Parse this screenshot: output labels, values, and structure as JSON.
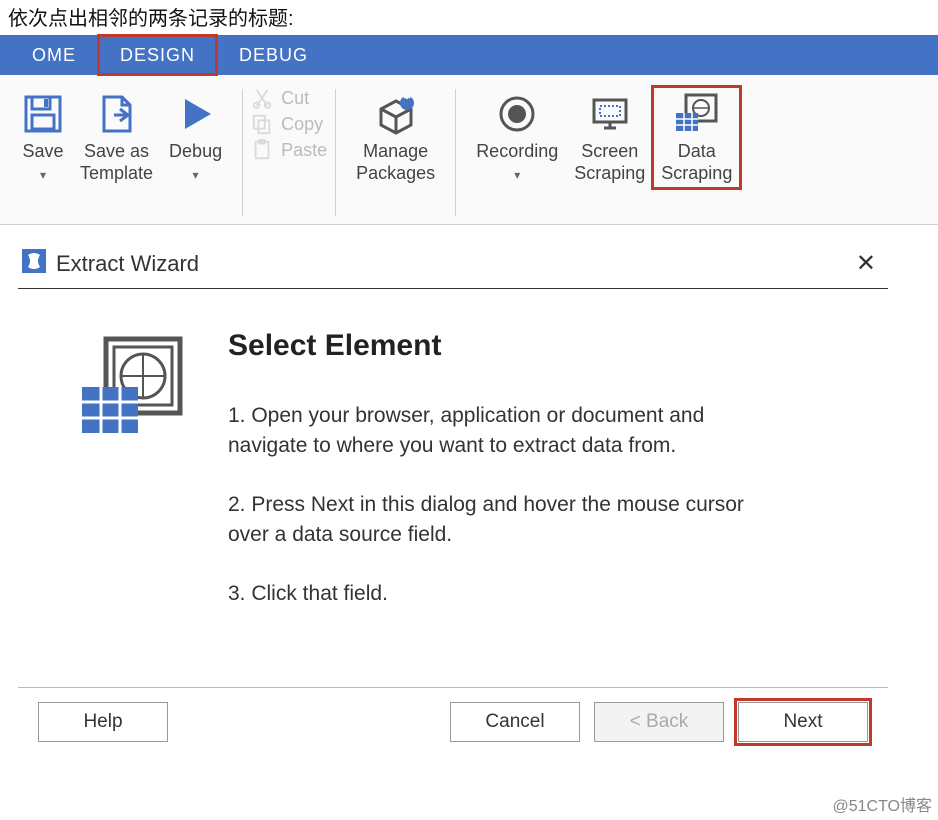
{
  "top_text": "依次点出相邻的两条记录的标题:",
  "tabs": {
    "home": "OME",
    "design": "DESIGN",
    "debug": "DEBUG"
  },
  "ribbon": {
    "save": "Save",
    "save_as_template": "Save as\nTemplate",
    "debug": "Debug",
    "cut": "Cut",
    "copy": "Copy",
    "paste": "Paste",
    "manage_packages": "Manage\nPackages",
    "recording": "Recording",
    "screen_scraping": "Screen\nScraping",
    "data_scraping": "Data\nScraping"
  },
  "dialog": {
    "title": "Extract Wizard",
    "heading": "Select Element",
    "step1": "1. Open your browser, application or document and navigate to where you want to extract data from.",
    "step2": "2. Press Next in this dialog and hover the mouse cursor over a data source field.",
    "step3": "3. Click that field.",
    "help": "Help",
    "cancel": "Cancel",
    "back": "< Back",
    "next": "Next"
  },
  "watermark": "@51CTO博客"
}
